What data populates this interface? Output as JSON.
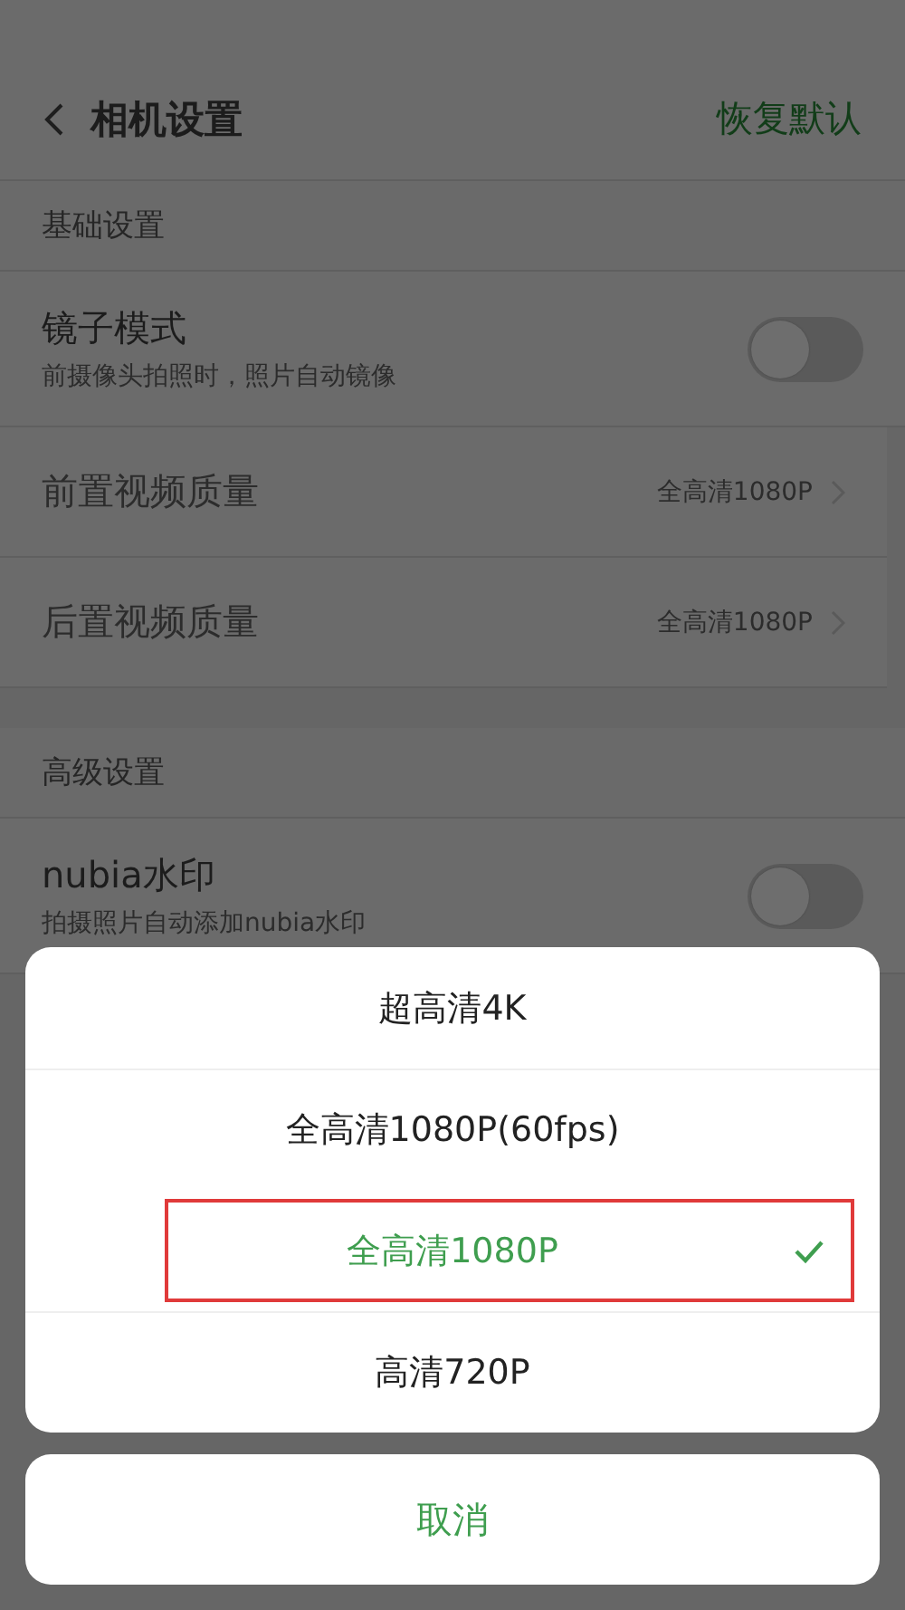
{
  "header": {
    "title": "相机设置",
    "action": "恢复默认"
  },
  "sections": [
    {
      "title": "基础设置",
      "items": [
        {
          "kind": "toggle",
          "label": "镜子模式",
          "description": "前摄像头拍照时，照片自动镜像",
          "on": false
        },
        {
          "kind": "value",
          "label": "前置视频质量",
          "value": "全高清1080P"
        },
        {
          "kind": "value",
          "label": "后置视频质量",
          "value": "全高清1080P"
        }
      ]
    },
    {
      "title": "高级设置",
      "items": [
        {
          "kind": "toggle",
          "label": "nubia水印",
          "description": "拍摄照片自动添加nubia水印",
          "on": false
        }
      ]
    }
  ],
  "sheet": {
    "options": [
      {
        "label": "超高清4K",
        "selected": false
      },
      {
        "label": "全高清1080P(60fps)",
        "selected": false
      },
      {
        "label": "全高清1080P",
        "selected": true
      },
      {
        "label": "高清720P",
        "selected": false
      }
    ],
    "cancel": "取消"
  }
}
